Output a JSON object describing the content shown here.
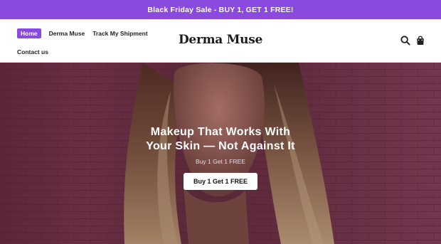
{
  "announcement": {
    "text": "Black Friday Sale - BUY 1, GET 1 FREE!"
  },
  "header": {
    "nav": [
      {
        "label": "Home",
        "active": true
      },
      {
        "label": "Derma Muse",
        "active": false
      },
      {
        "label": "Track My Shipment",
        "active": false
      },
      {
        "label": "Contact us",
        "active": false
      }
    ],
    "logo": "Derma Muse",
    "icons": {
      "search": "search-icon",
      "cart": "shopping-bag-icon"
    }
  },
  "hero": {
    "heading_line1": "Makeup That Works With",
    "heading_line2": "Your Skin — Not Against It",
    "subheading": "Buy 1 Get 1 FREE",
    "button_label": "Buy 1 Get 1 FREE"
  },
  "colors": {
    "accent": "#8a4ae0",
    "header_bg": "#ffffff",
    "hero_bg": "#6e2f45"
  }
}
